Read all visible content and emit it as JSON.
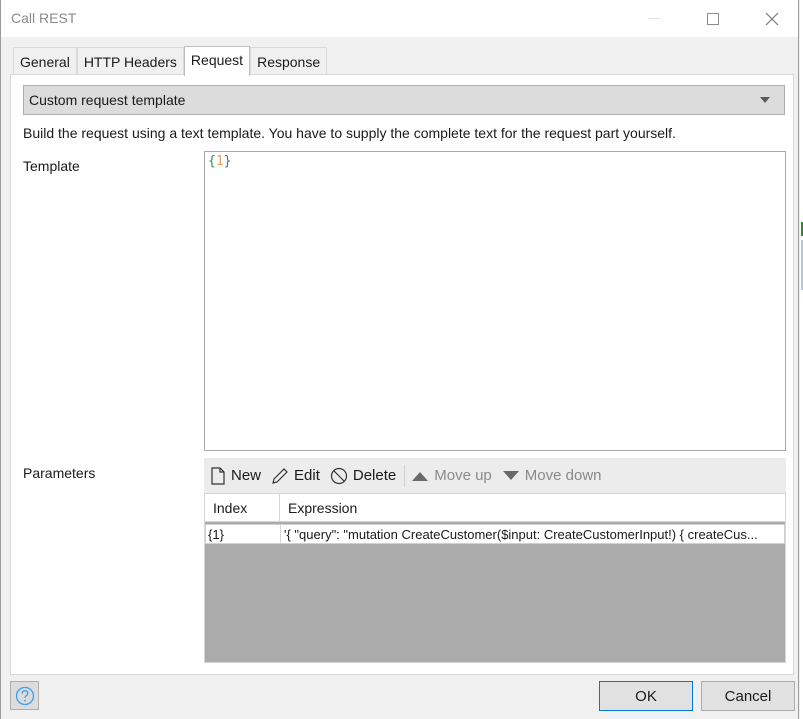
{
  "window": {
    "title": "Call REST",
    "controls": {
      "minimize": "minimize-icon",
      "maximize": "maximize-icon",
      "close": "close-icon"
    }
  },
  "tabs": [
    {
      "label": "General",
      "active": false
    },
    {
      "label": "HTTP Headers",
      "active": false
    },
    {
      "label": "Request",
      "active": true
    },
    {
      "label": "Response",
      "active": false
    }
  ],
  "request": {
    "mode_select": {
      "selected": "Custom request template"
    },
    "description": "Build the request using a text template. You have to supply the complete text for the request part yourself.",
    "template": {
      "label": "Template",
      "open_brace": "{",
      "number": "1",
      "close_brace": "}"
    },
    "parameters": {
      "label": "Parameters",
      "toolbar": {
        "new": "New",
        "edit": "Edit",
        "delete": "Delete",
        "move_up": "Move up",
        "move_down": "Move down"
      },
      "columns": {
        "index": "Index",
        "expression": "Expression"
      },
      "rows": [
        {
          "index": "{1}",
          "expression": "'{ \"query\": \"mutation CreateCustomer($input: CreateCustomerInput!) { createCus..."
        }
      ]
    }
  },
  "footer": {
    "help_icon": "help-icon",
    "ok": "OK",
    "cancel": "Cancel"
  },
  "colors": {
    "accent_focus": "#0078d7",
    "help_icon": "#3c9ff0",
    "grid_empty": "#ababab"
  }
}
